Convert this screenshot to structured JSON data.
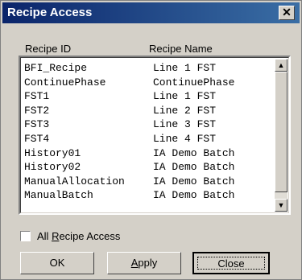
{
  "window": {
    "title": "Recipe Access",
    "close_glyph": "✕"
  },
  "columns": {
    "id_label": "Recipe ID",
    "name_label": "Recipe Name"
  },
  "recipes": [
    {
      "id": "BFI_Recipe",
      "name": "Line 1 FST"
    },
    {
      "id": "ContinuePhase",
      "name": "ContinuePhase"
    },
    {
      "id": "FST1",
      "name": "Line 1 FST"
    },
    {
      "id": "FST2",
      "name": "Line 2 FST"
    },
    {
      "id": "FST3",
      "name": "Line 3 FST"
    },
    {
      "id": "FST4",
      "name": "Line 4 FST"
    },
    {
      "id": "History01",
      "name": "IA Demo Batch"
    },
    {
      "id": "History02",
      "name": "IA Demo Batch"
    },
    {
      "id": "ManualAllocation",
      "name": "IA Demo Batch"
    },
    {
      "id": "ManualBatch",
      "name": "IA Demo Batch"
    }
  ],
  "all_access": {
    "label_prefix": "All ",
    "label_accel": "R",
    "label_rest": "ecipe Access",
    "checked": false
  },
  "buttons": {
    "ok": "OK",
    "apply_accel": "A",
    "apply_rest": "pply",
    "close": "Close"
  },
  "icons": {
    "scroll_up": "up-arrow-icon",
    "scroll_down": "down-arrow-icon"
  }
}
